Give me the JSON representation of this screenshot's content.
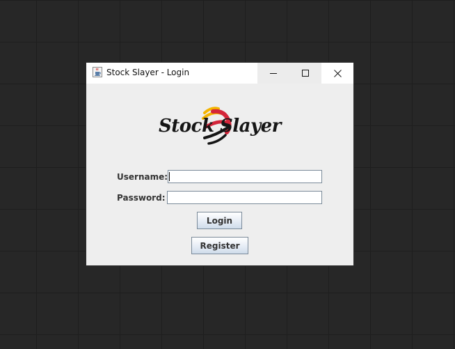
{
  "window": {
    "title": "Stock Slayer - Login",
    "icon": "java-cup-icon",
    "controls": [
      "minimize-icon",
      "maximize-icon",
      "close-icon"
    ]
  },
  "logo": {
    "text": "Stock Slayer",
    "colors": {
      "text": "#151515",
      "swirl_yellow": "#f4b400",
      "swirl_red": "#d4253a",
      "swirl_black": "#151515"
    }
  },
  "form": {
    "username_label": "Username:",
    "username_value": "",
    "password_label": "Password:",
    "password_value": ""
  },
  "buttons": {
    "login_label": "Login",
    "register_label": "Register"
  }
}
